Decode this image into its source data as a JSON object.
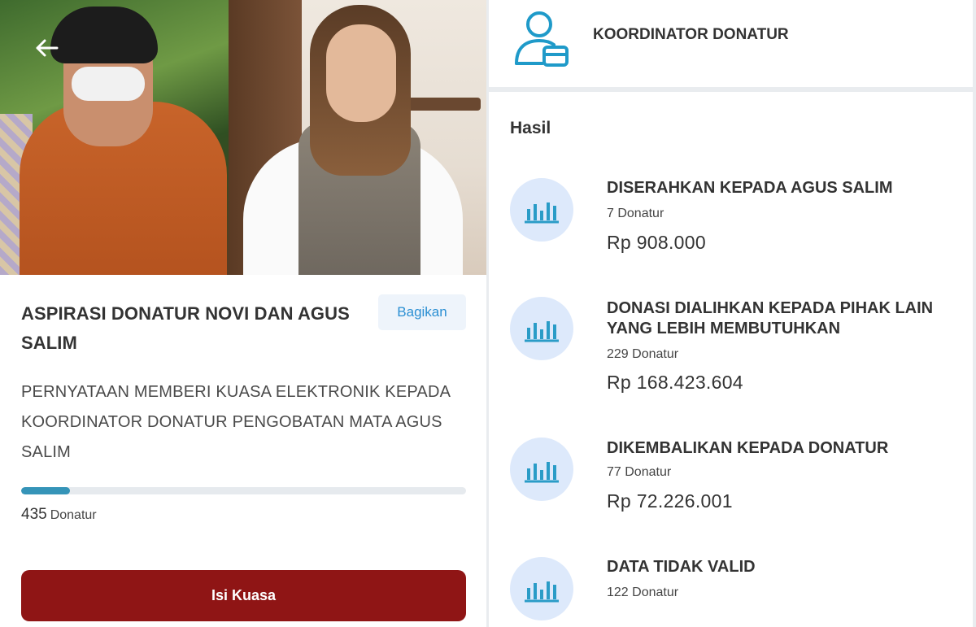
{
  "hero": {
    "back_icon": "arrow-left-icon"
  },
  "campaign": {
    "title": "ASPIRASI DONATUR NOVI DAN AGUS SALIM",
    "share_label": "Bagikan",
    "description": "PERNYATAAN MEMBERI KUASA ELEKTRONIK KEPADA KOORDINATOR DONATUR PENGOBATAN MATA AGUS SALIM",
    "progress_fraction": 0.11,
    "donor_count": "435",
    "donor_unit": "Donatur",
    "cta_label": "Isi Kuasa"
  },
  "coordinator": {
    "icon": "user-card-icon",
    "label": "KOORDINATOR DONATUR"
  },
  "results": {
    "heading": "Hasil",
    "items": [
      {
        "title": "DISERAHKAN KEPADA AGUS SALIM",
        "count": "7 Donatur",
        "amount": "Rp 908.000"
      },
      {
        "title": "DONASI DIALIHKAN KEPADA PIHAK LAIN YANG LEBIH MEMBUTUHKAN",
        "count": "229 Donatur",
        "amount": "Rp 168.423.604"
      },
      {
        "title": "DIKEMBALIKAN KEPADA DONATUR",
        "count": "77 Donatur",
        "amount": "Rp 72.226.001"
      },
      {
        "title": "DATA TIDAK VALID",
        "count": "122 Donatur",
        "amount": ""
      }
    ]
  },
  "colors": {
    "brand_red": "#8f1515",
    "accent_blue": "#2b8fd3",
    "progress": "#3594b8",
    "icon_bg": "#dde9fb"
  }
}
